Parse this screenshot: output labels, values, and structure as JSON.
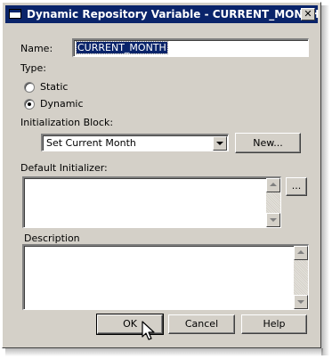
{
  "window": {
    "title": "Dynamic Repository Variable - CURRENT_MONTH",
    "close_glyph": "✕"
  },
  "form": {
    "name_label": "Name:",
    "name_value": "CURRENT_MONTH",
    "type_label": "Type:",
    "type_options": [
      {
        "label": "Static",
        "selected": false
      },
      {
        "label": "Dynamic",
        "selected": true
      }
    ],
    "init_block_label": "Initialization Block:",
    "init_block_value": "Set Current Month",
    "new_button": "New...",
    "default_initializer_label": "Default Initializer:",
    "default_initializer_value": "",
    "ellipsis_button": "...",
    "description_label": "Description",
    "description_value": ""
  },
  "buttons": {
    "ok": "OK",
    "cancel": "Cancel",
    "help": "Help"
  },
  "colors": {
    "titlebar": "#0a246a",
    "dialog_face": "#d4d0c8",
    "selection": "#0a246a"
  }
}
